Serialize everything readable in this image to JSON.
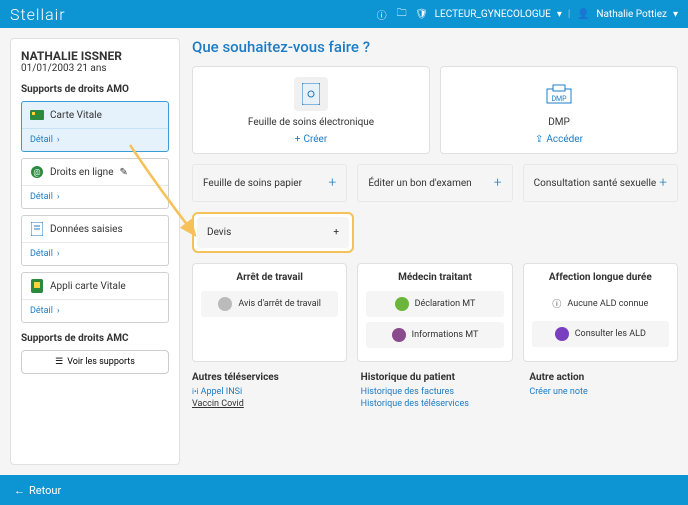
{
  "header": {
    "logo": "Stellair",
    "reader": "LECTEUR_GYNECOLOGUE",
    "user": "Nathalie Pottiez"
  },
  "patient": {
    "name": "NATHALIE ISSNER",
    "info": "01/01/2003 21 ans"
  },
  "sidebar": {
    "amo_title": "Supports de droits AMO",
    "amc_title": "Supports de droits AMC",
    "supports_btn": "Voir les supports",
    "cards": [
      {
        "label": "Carte Vitale",
        "detail": "Détail"
      },
      {
        "label": "Droits en ligne",
        "detail": "Détail"
      },
      {
        "label": "Données saisies",
        "detail": "Détail"
      },
      {
        "label": "Appli carte Vitale",
        "detail": "Détail"
      }
    ]
  },
  "content": {
    "title": "Que souhaitez-vous faire ?",
    "fse": {
      "label": "Feuille de soins électronique",
      "action": "Créer"
    },
    "dmp": {
      "label": "DMP",
      "action": "Accéder"
    },
    "small_tiles": [
      "Feuille de soins papier",
      "Éditer un bon d'examen",
      "Consultation santé sexuelle"
    ],
    "devis": "Devis",
    "panels": {
      "arret": {
        "title": "Arrêt de travail",
        "items": [
          "Avis d'arrêt de travail"
        ]
      },
      "medecin": {
        "title": "Médecin traitant",
        "items": [
          "Déclaration MT",
          "Informations MT"
        ]
      },
      "ald": {
        "title": "Affection longue durée",
        "items": [
          "Aucune ALD connue",
          "Consulter les ALD"
        ]
      }
    },
    "bottom": {
      "tele": {
        "title": "Autres téléservices",
        "links": [
          "Appel INSi",
          "Vaccin Covid"
        ]
      },
      "hist": {
        "title": "Historique du patient",
        "links": [
          "Historique des factures",
          "Historique des téléservices"
        ]
      },
      "autre": {
        "title": "Autre action",
        "links": [
          "Créer une note"
        ]
      }
    }
  },
  "footer": {
    "back": "Retour"
  }
}
